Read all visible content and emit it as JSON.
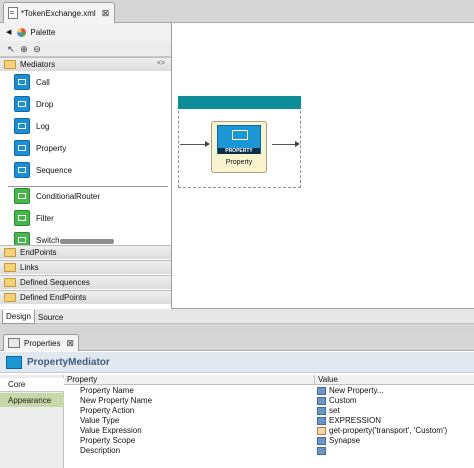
{
  "editor": {
    "tab_title": "*TokenExchange.xml",
    "tab_close": "⊠"
  },
  "palette": {
    "title": "Palette",
    "back_arrow": "◀",
    "tools": [
      "select-icon",
      "zoom-in-icon",
      "zoom-out-icon"
    ],
    "drawers": {
      "mediators": "Mediators",
      "endpoints": "EndPoints",
      "links": "Links",
      "defined_sequences": "Defined Sequences",
      "defined_endpoints": "Defined EndPoints"
    },
    "mediator_items": [
      {
        "label": "Call",
        "icon": "call-mediator-icon"
      },
      {
        "label": "Drop",
        "icon": "drop-mediator-icon"
      },
      {
        "label": "Log",
        "icon": "log-mediator-icon"
      },
      {
        "label": "Property",
        "icon": "property-mediator-icon"
      },
      {
        "label": "Sequence",
        "icon": "sequence-mediator-icon"
      },
      {
        "label": "ConditionalRouter",
        "icon": "conditional-router-icon"
      },
      {
        "label": "Filter",
        "icon": "filter-mediator-icon"
      },
      {
        "label": "Switch",
        "icon": "switch-mediator-icon"
      }
    ],
    "collapse_glyph": "<>"
  },
  "canvas": {
    "node_icon_text": "PROPERTY",
    "node_label": "Property",
    "accent_color": "#0d8d97"
  },
  "bottom_tabs": {
    "design": "Design",
    "source": "Source"
  },
  "properties_view": {
    "tab_label": "Properties",
    "tab_close": "⊠",
    "title": "PropertyMediator",
    "side_tabs": [
      "Core",
      "Appearance"
    ],
    "columns": {
      "property": "Property",
      "value": "Value"
    },
    "rows": [
      {
        "name": "Property Name",
        "value": "New Property..."
      },
      {
        "name": "New Property Name",
        "value": "Custom"
      },
      {
        "name": "Property Action",
        "value": "set"
      },
      {
        "name": "Value Type",
        "value": "EXPRESSION"
      },
      {
        "name": "Value Expression",
        "value": "get-property('transport', 'Custom')"
      },
      {
        "name": "Property Scope",
        "value": "Synapse"
      },
      {
        "name": "Description",
        "value": ""
      }
    ]
  }
}
